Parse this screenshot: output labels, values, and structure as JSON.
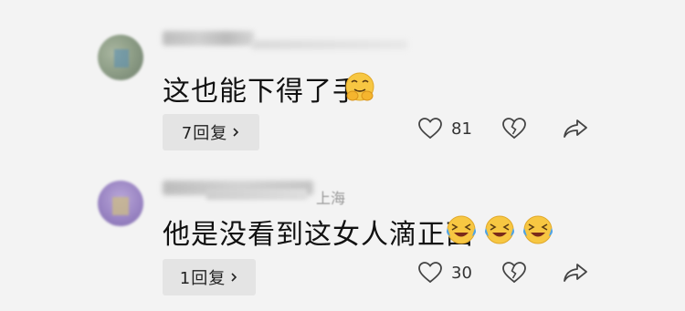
{
  "comments": [
    {
      "text": "这也能下得了手",
      "reply_label": "7回复",
      "likes": "81",
      "emoji": [
        "smirk-hands-face"
      ]
    },
    {
      "location": "上海",
      "text": "他是没看到这女人滴正面",
      "reply_label": "1回复",
      "likes": "30",
      "emoji": [
        "laugh-cry-face",
        "laugh-cry-face",
        "laugh-cry-face"
      ]
    }
  ],
  "icons": {
    "like": "heart-icon",
    "dislike": "broken-heart-icon",
    "share": "share-arrow-icon",
    "reply": "chevron-right-icon"
  },
  "colors": {
    "background": "#f3f3f3",
    "reply_button": "#e4e4e4",
    "text": "#111111",
    "emoji_yellow": "#f7c742"
  }
}
